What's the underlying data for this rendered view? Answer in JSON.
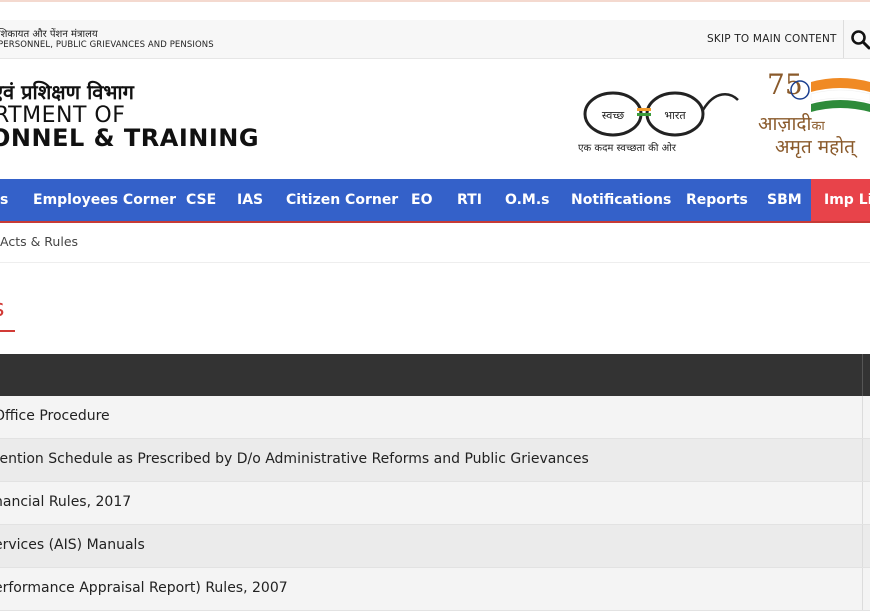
{
  "utility_bar": {
    "ministry_hindi": "शिकायत और पेंशन मंत्रालय",
    "ministry_english": "PERSONNEL, PUBLIC GRIEVANCES AND PENSIONS",
    "skip_link": "SKIP TO MAIN CONTENT",
    "search_icon": "search-icon"
  },
  "branding": {
    "dept_hindi": "एवं प्रशिक्षण विभाग",
    "dept_english_line1": "RTMENT OF",
    "dept_english_line2": "ONNEL & TRAINING",
    "swachh_left": "स्वच्छ",
    "swachh_right": "भारत",
    "swachh_caption": "एक कदम स्वच्छता की ओर",
    "azadi_line1_main": "आज़ादी",
    "azadi_line1_ka": "का",
    "azadi_line2": "अमृत महोत्",
    "azadi_number": "75"
  },
  "nav": {
    "items": [
      "s",
      "Employees Corner",
      "CSE",
      "IAS",
      "Citizen Corner",
      "EO",
      "RTI",
      "O.M.s",
      "Notifications",
      "Reports",
      "SBM",
      "Imp Lin"
    ]
  },
  "breadcrumb": "Acts & Rules",
  "page_title": "s",
  "table": {
    "rows": [
      "Office Procedure",
      "tention Schedule as Prescribed by D/o Administrative Reforms and Public Grievances",
      "nancial Rules, 2017",
      "ervices (AIS) Manuals",
      "erformance Appraisal Report) Rules, 2007"
    ]
  },
  "colors": {
    "nav_bg": "#3461c9",
    "nav_highlight": "#e8434a",
    "title_red": "#d23b36",
    "table_header": "#333333"
  }
}
